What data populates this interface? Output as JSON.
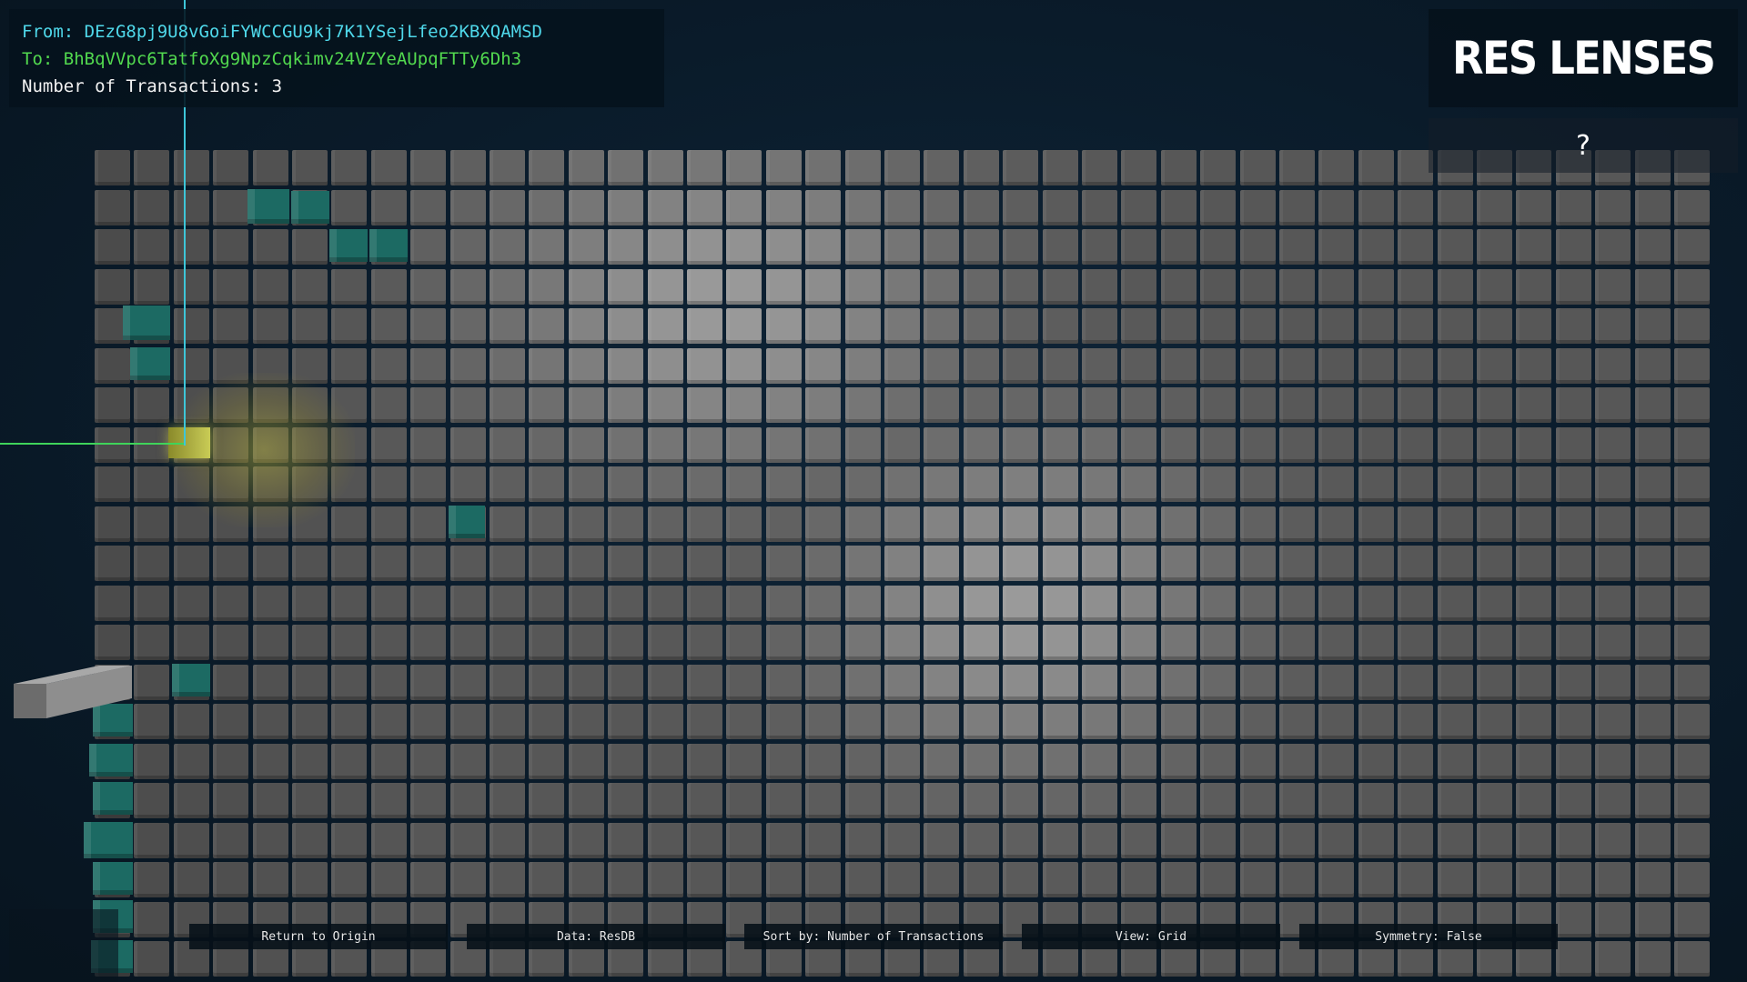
{
  "info": {
    "from_label": "From:",
    "from_value": "DEzG8pj9U8vGoiFYWCCGU9kj7K1YSejLfeo2KBXQAMSD",
    "to_label": "To:",
    "to_value": "BhBqVVpc6TatfoXg9NpzCqkimv24VZYeAUpqFTTy6Dh3",
    "count_label": "Number of Transactions:",
    "count_value": "3"
  },
  "title": "RES LENSES",
  "help": "?",
  "toolbar": {
    "return_label": "Return to Origin",
    "data_label": "Data: ResDB",
    "sort_label": "Sort by: Number of Transactions",
    "view_label": "View: Grid",
    "symmetry_label": "Symmetry: False"
  },
  "colors": {
    "from_text": "#4fd8ea",
    "to_text": "#52d94f",
    "highlight_cube": "#1c6a63",
    "selected_cube": "#c9cc55"
  }
}
